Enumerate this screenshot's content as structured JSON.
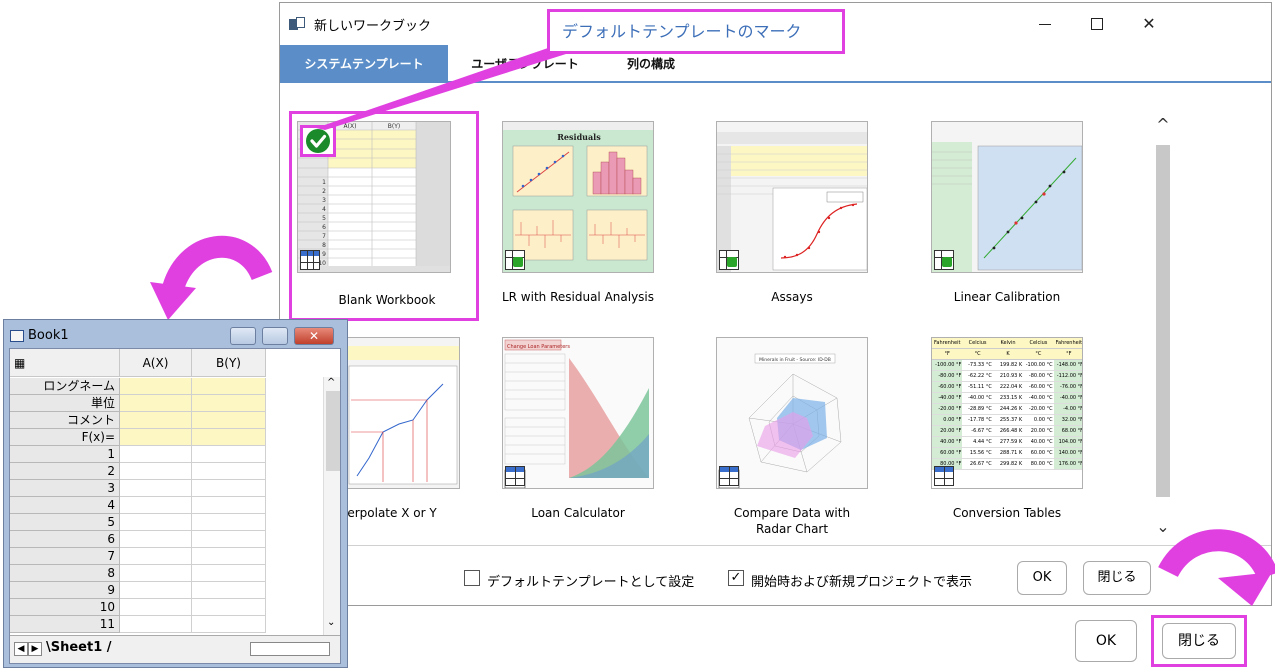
{
  "dialog": {
    "title": "新しいワークブック",
    "tabs": [
      {
        "label": "システムテンプレート",
        "active": true
      },
      {
        "label": "ユーザテンプレート",
        "active": false
      },
      {
        "label": "列の構成",
        "active": false
      }
    ],
    "templates": [
      {
        "label": "Blank Workbook",
        "selected": true,
        "icon": "workbook-icon"
      },
      {
        "label": "LR with Residual Analysis",
        "selected": false,
        "icon": "locked-workbook-icon"
      },
      {
        "label": "Assays",
        "selected": false,
        "icon": "locked-workbook-icon"
      },
      {
        "label": "Linear Calibration",
        "selected": false,
        "icon": "locked-workbook-icon"
      },
      {
        "label": "Interpolate X or Y",
        "visible_label": "erpolate X or Y",
        "selected": false,
        "icon": "workbook-icon"
      },
      {
        "label": "Loan Calculator",
        "selected": false,
        "icon": "workbook-icon"
      },
      {
        "label": "Compare Data with Radar Chart",
        "selected": false,
        "icon": "workbook-icon"
      },
      {
        "label": "Conversion Tables",
        "selected": false,
        "icon": "workbook-icon"
      }
    ],
    "thumb_texts": {
      "lr_title": "Residuals",
      "loan_header": "Change Loan Parameters",
      "radar_title": "Minerals in Fruit - Source: ID-DB",
      "conv_headers": [
        "Fahrenheit",
        "Celcius",
        "Kelvin",
        "Celcius",
        "Fahrenheit"
      ],
      "conv_units": [
        "°F",
        "°C",
        "K",
        "°C",
        "°F"
      ],
      "conv_rows": [
        [
          "-100.00 °F",
          "-73.33 °C",
          "199.82 K",
          "-100.00 °C",
          "-148.00 °F"
        ],
        [
          "-80.00 °F",
          "-62.22 °C",
          "210.93 K",
          "-80.00 °C",
          "-112.00 °F"
        ],
        [
          "-60.00 °F",
          "-51.11 °C",
          "222.04 K",
          "-60.00 °C",
          "-76.00 °F"
        ],
        [
          "-40.00 °F",
          "-40.00 °C",
          "233.15 K",
          "-40.00 °C",
          "-40.00 °F"
        ],
        [
          "-20.00 °F",
          "-28.89 °C",
          "244.26 K",
          "-20.00 °C",
          "-4.00 °F"
        ],
        [
          "0.00 °F",
          "-17.78 °C",
          "255.37 K",
          "0.00 °C",
          "32.00 °F"
        ],
        [
          "20.00 °F",
          "-6.67 °C",
          "266.48 K",
          "20.00 °C",
          "68.00 °F"
        ],
        [
          "40.00 °F",
          "4.44 °C",
          "277.59 K",
          "40.00 °C",
          "104.00 °F"
        ],
        [
          "60.00 °F",
          "15.56 °C",
          "288.71 K",
          "60.00 °C",
          "140.00 °F"
        ],
        [
          "80.00 °F",
          "26.67 °C",
          "299.82 K",
          "80.00 °C",
          "176.00 °F"
        ]
      ]
    },
    "checkbox_default": {
      "label": "デフォルトテンプレートとして設定",
      "checked": false
    },
    "checkbox_show": {
      "label": "開始時および新規プロジェクトで表示",
      "checked": true
    },
    "ok_label": "OK",
    "close_label": "閉じる"
  },
  "callout": {
    "text": "デフォルトテンプレートのマーク"
  },
  "book": {
    "title": "Book1",
    "columns": [
      "A(X)",
      "B(Y)"
    ],
    "label_rows": [
      "ロングネーム",
      "単位",
      "コメント",
      "F(x)="
    ],
    "row_numbers": [
      "1",
      "2",
      "3",
      "4",
      "5",
      "6",
      "7",
      "8",
      "9",
      "10",
      "11"
    ],
    "sheet_tab": "Sheet1"
  },
  "big_buttons": {
    "ok": "OK",
    "close": "閉じる"
  },
  "colors": {
    "accent": "#5b8ec8",
    "highlight": "#e040e0",
    "callout_text": "#3d6fb8",
    "check_green": "#1a8a2a"
  }
}
